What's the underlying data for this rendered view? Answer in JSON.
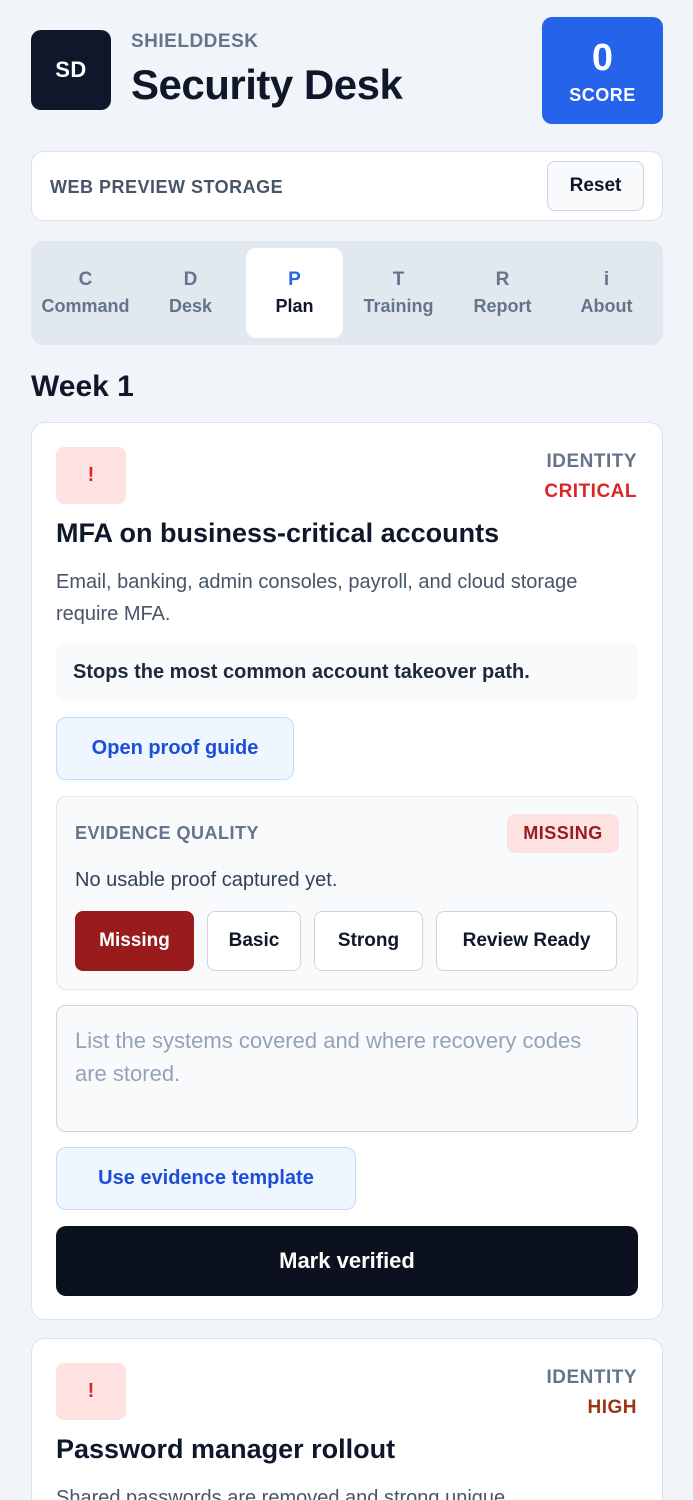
{
  "header": {
    "logo": "SD",
    "brand": "SHIELDDESK",
    "title": "Security Desk",
    "score_value": "0",
    "score_label": "SCORE"
  },
  "storage": {
    "label": "WEB PREVIEW STORAGE",
    "reset_label": "Reset"
  },
  "tabs": [
    {
      "letter": "C",
      "label": "Command"
    },
    {
      "letter": "D",
      "label": "Desk"
    },
    {
      "letter": "P",
      "label": "Plan",
      "active": true
    },
    {
      "letter": "T",
      "label": "Training"
    },
    {
      "letter": "R",
      "label": "Report"
    },
    {
      "letter": "i",
      "label": "About"
    }
  ],
  "week_heading": "Week 1",
  "cards": [
    {
      "icon": "!",
      "category": "IDENTITY",
      "severity": "CRITICAL",
      "title": "MFA on business-critical accounts",
      "description": "Email, banking, admin consoles, payroll, and cloud storage require MFA.",
      "impact": "Stops the most common account takeover path.",
      "proof_guide_label": "Open proof guide",
      "evidence": {
        "label": "EVIDENCE QUALITY",
        "badge": "MISSING",
        "status_text": "No usable proof captured yet.",
        "options": [
          "Missing",
          "Basic",
          "Strong",
          "Review Ready"
        ],
        "selected": "Missing"
      },
      "notes_placeholder": "List the systems covered and where recovery codes are stored.",
      "template_label": "Use evidence template",
      "verify_label": "Mark verified"
    },
    {
      "icon": "!",
      "category": "IDENTITY",
      "severity": "HIGH",
      "title": "Password manager rollout",
      "description": "Shared passwords are removed and strong unique"
    }
  ],
  "colors": {
    "accent": "#2563eb",
    "dark": "#0f172a",
    "critical": "#dc2626",
    "high": "#9a3412",
    "missing": "#991b1b"
  }
}
